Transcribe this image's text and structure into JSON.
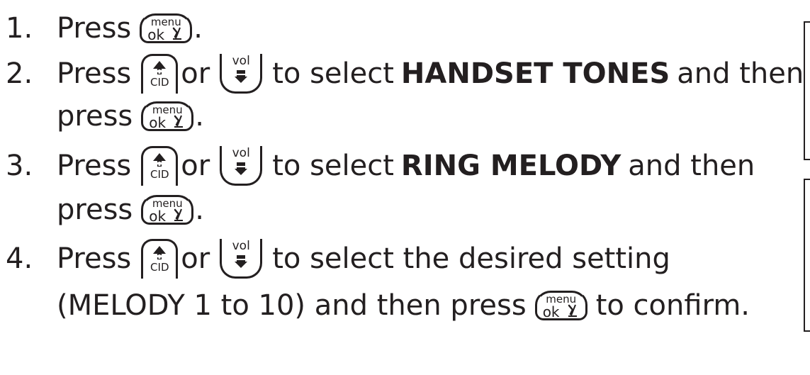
{
  "keys": {
    "menu_top": "menu",
    "menu_bottom": "ok",
    "cid_label": "CID",
    "vol_label": "vol"
  },
  "steps": [
    {
      "number": "1.",
      "press": "Press",
      "end": "."
    },
    {
      "number": "2.",
      "press": "Press",
      "or": "or",
      "select": "to select",
      "target": "HANDSET TONES",
      "and_then": "and then",
      "press2": "press",
      "end": "."
    },
    {
      "number": "3.",
      "press": "Press",
      "or": "or",
      "select": "to select",
      "target": "RING MELODY",
      "and_then": "and then",
      "press2": "press",
      "end": "."
    },
    {
      "number": "4.",
      "press": "Press",
      "or": "or",
      "select": "to select the desired setting",
      "line2_prefix": "(MELODY 1 to 10) and then press",
      "line2_suffix": "to confirm."
    }
  ]
}
